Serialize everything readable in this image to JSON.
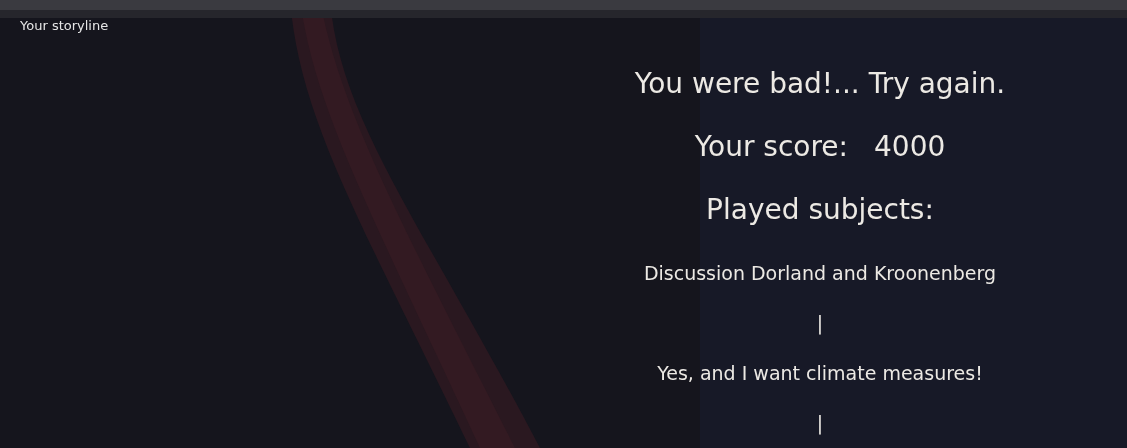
{
  "header": {
    "title": "Your storyline"
  },
  "result": {
    "message": "You were bad!... Try again."
  },
  "score": {
    "label": "Your score:",
    "value": "4000"
  },
  "subjects": {
    "heading": "Played subjects:",
    "items": [
      "Discussion Dorland and Kroonenberg",
      "|",
      "Yes, and I want climate measures!",
      "|"
    ]
  }
}
